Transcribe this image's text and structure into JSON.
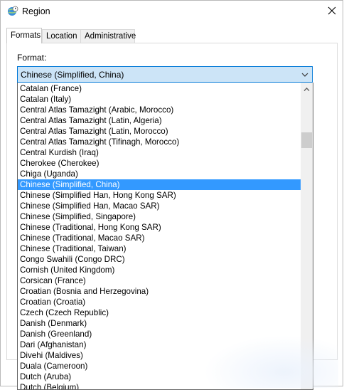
{
  "window": {
    "title": "Region",
    "icon": "globe-clock-icon",
    "close_icon": "close-icon"
  },
  "tabs": [
    {
      "label": "Formats",
      "active": true
    },
    {
      "label": "Location",
      "active": false
    },
    {
      "label": "Administrative",
      "active": false
    }
  ],
  "format": {
    "label": "Format:",
    "selected_value": "Chinese (Simplified, China)",
    "options": [
      "Catalan (France)",
      "Catalan (Italy)",
      "Central Atlas Tamazight (Arabic, Morocco)",
      "Central Atlas Tamazight (Latin, Algeria)",
      "Central Atlas Tamazight (Latin, Morocco)",
      "Central Atlas Tamazight (Tifinagh, Morocco)",
      "Central Kurdish (Iraq)",
      "Cherokee (Cherokee)",
      "Chiga (Uganda)",
      "Chinese (Simplified, China)",
      "Chinese (Simplified Han, Hong Kong SAR)",
      "Chinese (Simplified Han, Macao SAR)",
      "Chinese (Simplified, Singapore)",
      "Chinese (Traditional, Hong Kong SAR)",
      "Chinese (Traditional, Macao SAR)",
      "Chinese (Traditional, Taiwan)",
      "Congo Swahili (Congo DRC)",
      "Cornish (United Kingdom)",
      "Corsican (France)",
      "Croatian (Bosnia and Herzegovina)",
      "Croatian (Croatia)",
      "Czech (Czech Republic)",
      "Danish (Denmark)",
      "Danish (Greenland)",
      "Dari (Afghanistan)",
      "Divehi (Maldives)",
      "Duala (Cameroon)",
      "Dutch (Aruba)",
      "Dutch (Belgium)"
    ],
    "selected_index": 9
  },
  "colors": {
    "selection": "#3399ff",
    "combo_focus_border": "#0078d7",
    "combo_focus_fill": "#cce4f7"
  }
}
